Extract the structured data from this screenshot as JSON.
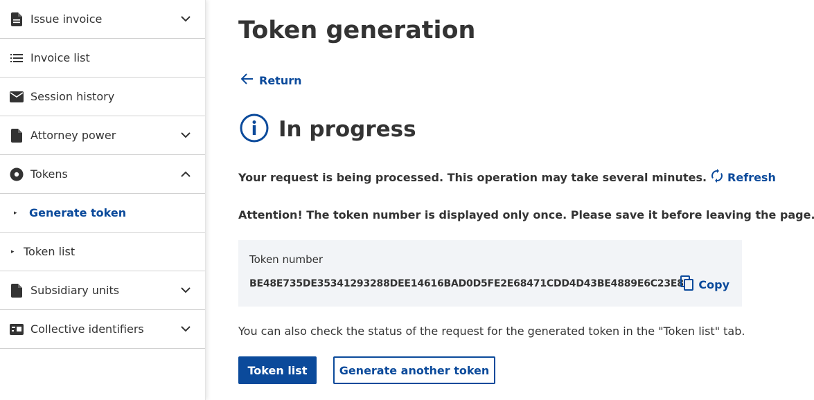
{
  "sidebar": {
    "items": [
      {
        "label": "Issue invoice",
        "icon": "document-icon",
        "chevron": "down"
      },
      {
        "label": "Invoice list",
        "icon": "list-icon",
        "chevron": ""
      },
      {
        "label": "Session history",
        "icon": "envelope-icon",
        "chevron": ""
      },
      {
        "label": "Attorney power",
        "icon": "document-icon",
        "chevron": "down"
      },
      {
        "label": "Tokens",
        "icon": "disc-icon",
        "chevron": "up"
      }
    ],
    "sub_items": [
      {
        "label": "Generate token",
        "active": true
      },
      {
        "label": "Token list",
        "active": false
      }
    ],
    "bottom_items": [
      {
        "label": "Subsidiary units",
        "icon": "document-icon",
        "chevron": "down"
      },
      {
        "label": "Collective identifiers",
        "icon": "id-card-icon",
        "chevron": "down"
      }
    ]
  },
  "main": {
    "title": "Token generation",
    "return_label": "Return",
    "status_title": "In progress",
    "message": "Your request is being processed. This operation may take several minutes.",
    "refresh_label": "Refresh",
    "attention": "Attention! The token number is displayed only once. Please save it before leaving the page.",
    "token_label": "Token number",
    "token_value": "BE48E735DE35341293288DEE14616BAD0D5FE2E68471CDD4D43BE4889E6C23E8",
    "copy_label": "Copy",
    "info_text": "You can also check the status of the request for the generated token in the \"Token list\" tab.",
    "btn_token_list": "Token list",
    "btn_generate_another": "Generate another token"
  },
  "colors": {
    "accent": "#0b4a9b",
    "text": "#333333",
    "token_box_bg": "#f2f4f7"
  }
}
